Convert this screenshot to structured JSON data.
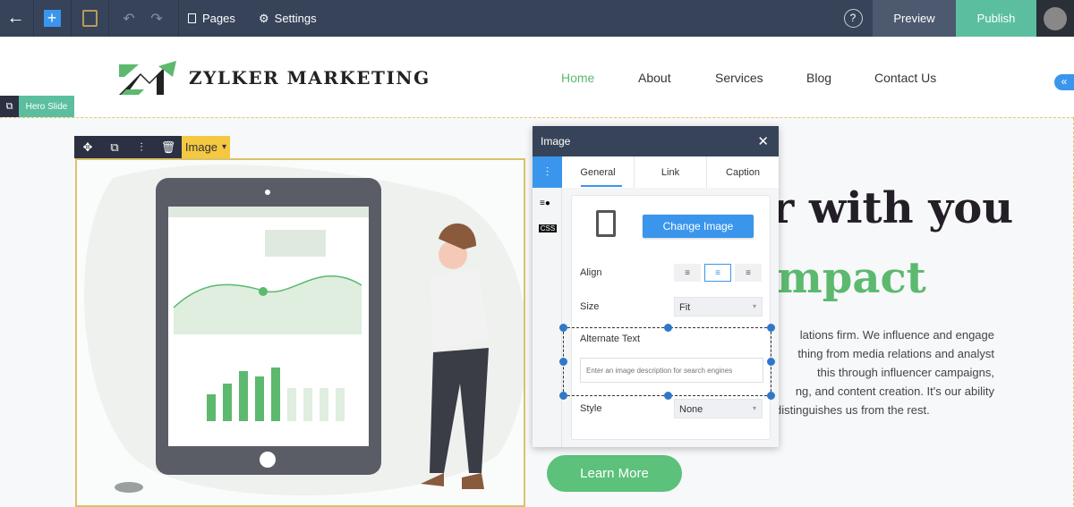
{
  "topbar": {
    "pages": "Pages",
    "settings": "Settings",
    "preview": "Preview",
    "publish": "Publish"
  },
  "site": {
    "logo_text": "ZYLKER MARKETING",
    "nav": [
      "Home",
      "About",
      "Services",
      "Blog",
      "Contact Us"
    ],
    "active_nav": "Home"
  },
  "editor": {
    "section_label": "Hero Slide",
    "element_label": "Image"
  },
  "hero": {
    "headline_1": "r with you",
    "headline_2": "mpact",
    "paragraph": [
      "lations firm. We influence and engage",
      "thing from media relations and analyst",
      "this through influencer campaigns,",
      "ng, and content creation. It's our ability",
      "distinguishes us from the rest."
    ],
    "button": "Learn More"
  },
  "panel": {
    "title": "Image",
    "tabs": [
      "General",
      "Link",
      "Caption"
    ],
    "active_tab": "General",
    "css_label": "CSS",
    "change_image": "Change Image",
    "align_label": "Align",
    "align_value": "center",
    "size_label": "Size",
    "size_value": "Fit",
    "alt_label": "Alternate Text",
    "alt_placeholder": "Enter an image description for search engines",
    "style_label": "Style",
    "style_value": "None"
  },
  "colors": {
    "topbar": "#364359",
    "publish": "#5bbf9f",
    "accent_green": "#5cb96e",
    "panel_blue": "#3a96ec"
  }
}
